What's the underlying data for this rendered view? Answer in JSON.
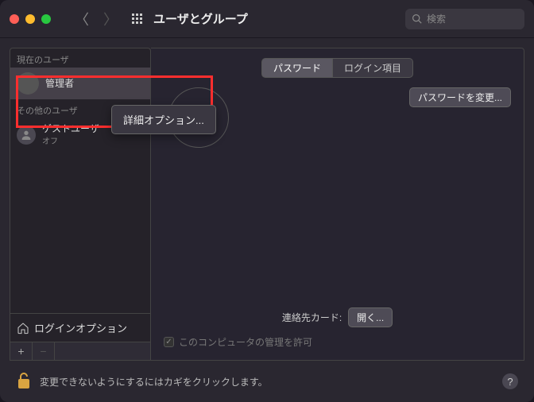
{
  "titlebar": {
    "title": "ユーザとグループ",
    "search_placeholder": "検索"
  },
  "sidebar": {
    "current_header": "現在のユーザ",
    "other_header": "その他のユーザ",
    "admin_label": "管理者",
    "guest_label": "ゲストユーザ",
    "guest_sub": "オフ",
    "login_options": "ログインオプション"
  },
  "tabs": {
    "password": "パスワード",
    "login_items": "ログイン項目"
  },
  "main": {
    "change_password": "パスワードを変更...",
    "contact_label": "連絡先カード:",
    "open_btn": "開く...",
    "admin_check": "このコンピュータの管理を許可"
  },
  "context": {
    "advanced": "詳細オプション..."
  },
  "footer": {
    "lock_text": "変更できないようにするにはカギをクリックします。"
  }
}
